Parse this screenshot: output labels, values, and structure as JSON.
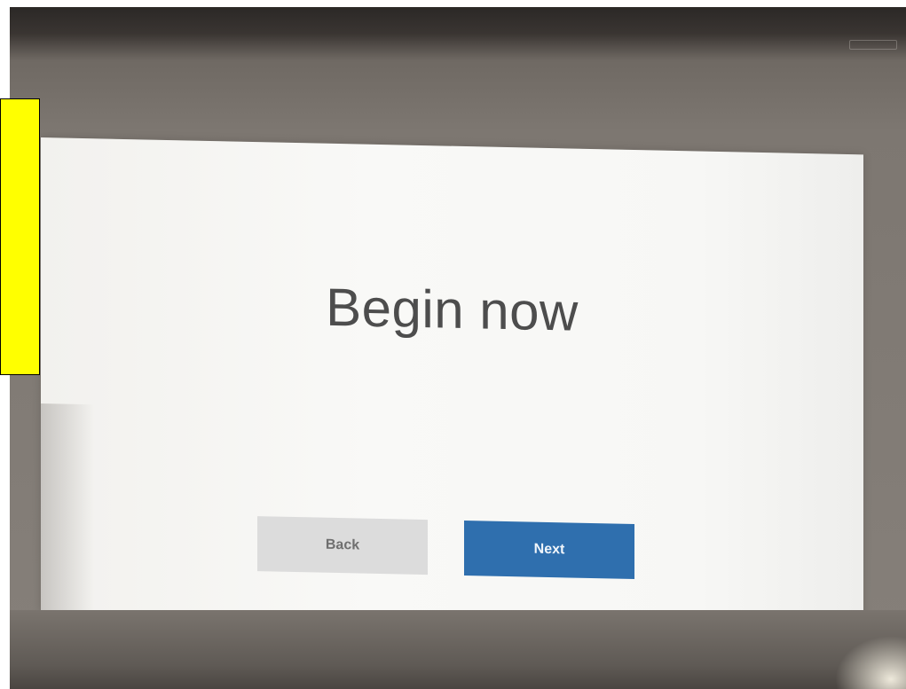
{
  "screen": {
    "heading": "Begin now"
  },
  "buttons": {
    "back_label": "Back",
    "next_label": "Next"
  },
  "colors": {
    "next_button": "#2f6fae",
    "back_button": "#dcdcdc",
    "highlight_box": "#ffff00"
  }
}
